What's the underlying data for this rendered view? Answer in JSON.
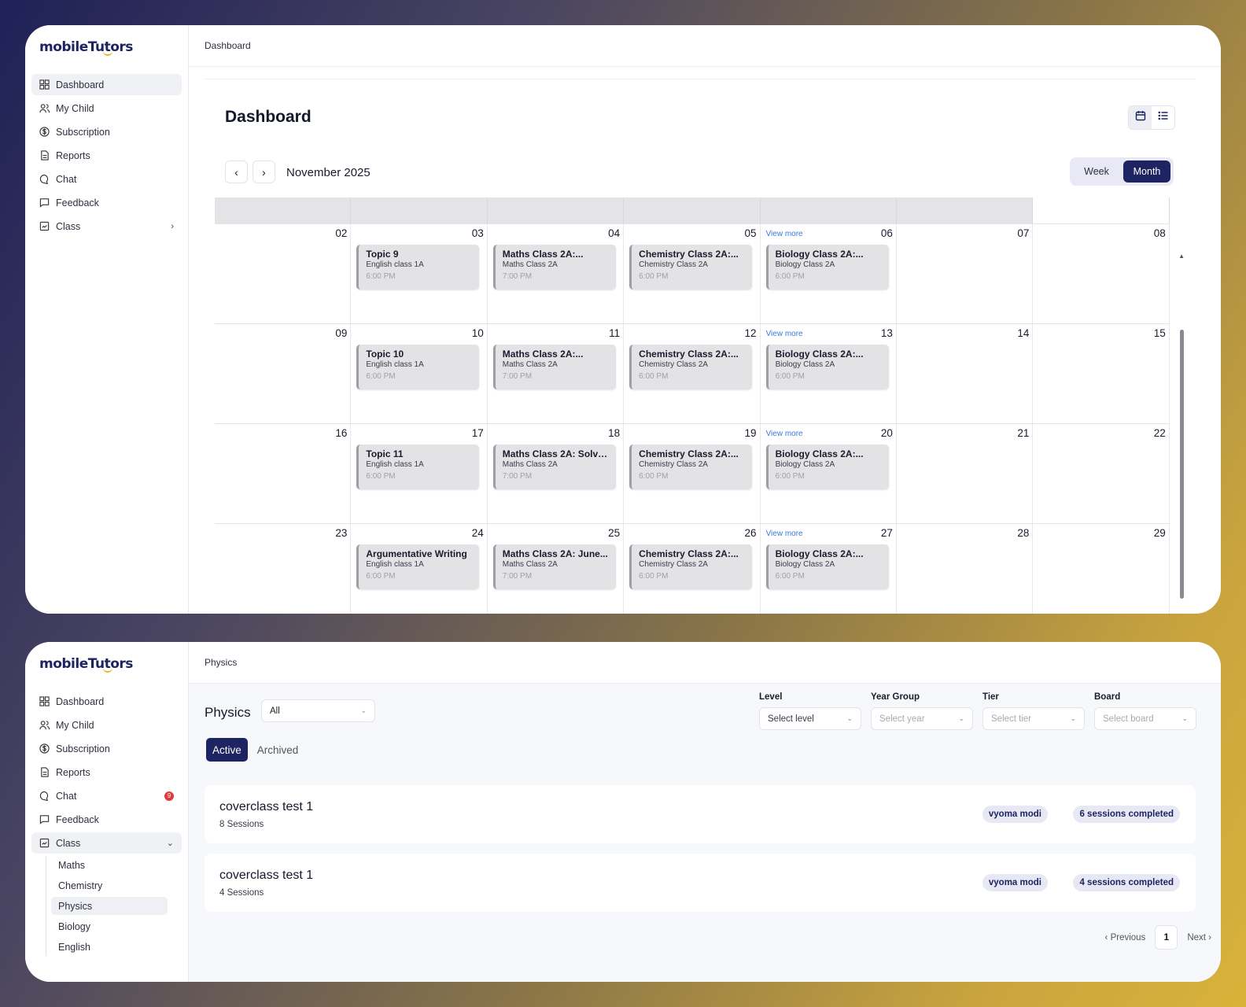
{
  "brand": {
    "logo_text": "mobileTutors"
  },
  "sidebar": {
    "items": [
      {
        "label": "Dashboard",
        "icon": "grid-icon"
      },
      {
        "label": "My Child",
        "icon": "users-icon"
      },
      {
        "label": "Subscription",
        "icon": "dollar-circle-icon"
      },
      {
        "label": "Reports",
        "icon": "document-icon"
      },
      {
        "label": "Chat",
        "icon": "chat-bubble-icon"
      },
      {
        "label": "Feedback",
        "icon": "message-square-icon"
      },
      {
        "label": "Class",
        "icon": "class-icon"
      }
    ],
    "class_subitems": [
      "Maths",
      "Chemistry",
      "Physics",
      "Biology",
      "English"
    ],
    "chat_badge": "9"
  },
  "dashboard": {
    "breadcrumb": "Dashboard",
    "title": "Dashboard",
    "month_label": "November 2025",
    "week_label": "Week",
    "month_btn_label": "Month",
    "view_more": "View more",
    "weeks": [
      {
        "days": [
          "02",
          "03",
          "04",
          "05",
          "06",
          "07",
          "08"
        ],
        "events": [
          {
            "title": "Topic 9",
            "sub": "English class 1A",
            "time": "6:00 PM"
          },
          {
            "title": "Maths Class 2A:...",
            "sub": "Maths Class 2A",
            "time": "7:00 PM"
          },
          {
            "title": "Chemistry Class 2A:...",
            "sub": "Chemistry Class 2A",
            "time": "6:00 PM"
          },
          {
            "title": "Biology Class 2A:...",
            "sub": "Biology Class 2A",
            "time": "6:00 PM"
          }
        ]
      },
      {
        "days": [
          "09",
          "10",
          "11",
          "12",
          "13",
          "14",
          "15"
        ],
        "events": [
          {
            "title": "Topic 10",
            "sub": "English class 1A",
            "time": "6:00 PM"
          },
          {
            "title": "Maths Class 2A:...",
            "sub": "Maths Class 2A",
            "time": "7:00 PM"
          },
          {
            "title": "Chemistry Class 2A:...",
            "sub": "Chemistry Class 2A",
            "time": "6:00 PM"
          },
          {
            "title": "Biology Class 2A:...",
            "sub": "Biology Class 2A",
            "time": "6:00 PM"
          }
        ]
      },
      {
        "days": [
          "16",
          "17",
          "18",
          "19",
          "20",
          "21",
          "22"
        ],
        "events": [
          {
            "title": "Topic 11",
            "sub": "English class 1A",
            "time": "6:00 PM"
          },
          {
            "title": "Maths Class 2A: Solvin...",
            "sub": "Maths Class 2A",
            "time": "7:00 PM"
          },
          {
            "title": "Chemistry Class 2A:...",
            "sub": "Chemistry Class 2A",
            "time": "6:00 PM"
          },
          {
            "title": "Biology Class 2A:...",
            "sub": "Biology Class 2A",
            "time": "6:00 PM"
          }
        ]
      },
      {
        "days": [
          "23",
          "24",
          "25",
          "26",
          "27",
          "28",
          "29"
        ],
        "events": [
          {
            "title": "Argumentative Writing",
            "sub": "English class 1A",
            "time": "6:00 PM"
          },
          {
            "title": "Maths Class 2A: June...",
            "sub": "Maths Class 2A",
            "time": "7:00 PM"
          },
          {
            "title": "Chemistry Class 2A:...",
            "sub": "Chemistry Class 2A",
            "time": "6:00 PM"
          },
          {
            "title": "Biology Class 2A:...",
            "sub": "Biology Class 2A",
            "time": "6:00 PM"
          }
        ]
      }
    ]
  },
  "physics": {
    "breadcrumb": "Physics",
    "title": "Physics",
    "select_value": "All",
    "filters": [
      {
        "label": "Level",
        "placeholder": "Select level"
      },
      {
        "label": "Year Group",
        "placeholder": "Select year"
      },
      {
        "label": "Tier",
        "placeholder": "Select tier"
      },
      {
        "label": "Board",
        "placeholder": "Select board"
      }
    ],
    "tabs": [
      "Active",
      "Archived"
    ],
    "classes": [
      {
        "title": "coverclass test 1",
        "sessions": "8 Sessions",
        "tutor": "vyoma modi",
        "completed": "6 sessions completed"
      },
      {
        "title": "coverclass test 1",
        "sessions": "4 Sessions",
        "tutor": "vyoma modi",
        "completed": "4 sessions completed"
      }
    ],
    "pager": {
      "previous": "Previous",
      "page": "1",
      "next": "Next"
    }
  }
}
